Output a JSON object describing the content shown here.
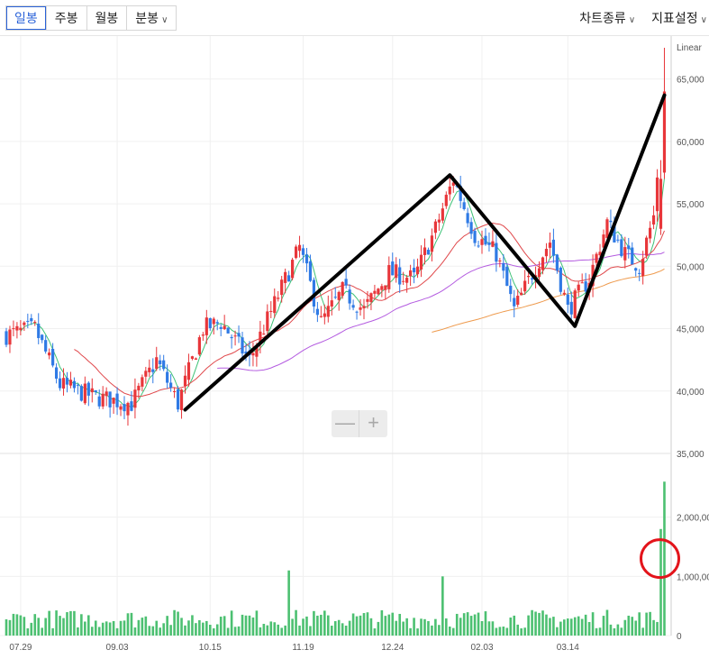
{
  "toolbar": {
    "period_tabs": [
      {
        "label": "일봉",
        "active": true,
        "has_dropdown": false
      },
      {
        "label": "주봉",
        "active": false,
        "has_dropdown": false
      },
      {
        "label": "월봉",
        "active": false,
        "has_dropdown": false
      },
      {
        "label": "분봉",
        "active": false,
        "has_dropdown": true
      }
    ],
    "chart_type_label": "차트종류",
    "indicator_label": "지표설정",
    "dropdown_icon": "chevron-down-icon"
  },
  "zoom": {
    "minus_icon": "minus-icon",
    "plus_icon": "plus-icon"
  },
  "colors": {
    "up": "#e8363a",
    "down": "#2f7ae5",
    "volume": "#4cc071",
    "ma5": "#3ec277",
    "ma20": "#e0484b",
    "ma60": "#b45ce0",
    "ma120": "#ee9a4d",
    "drawing": "#000000",
    "highlight_circle": "#e3141b",
    "grid": "#f0f0f0"
  },
  "chart_data": {
    "type": "candlestick",
    "scale_label": "Linear",
    "price_axis": {
      "ylim": [
        35000,
        67500
      ],
      "ticks": [
        "35,000",
        "40,000",
        "45,000",
        "50,000",
        "55,000",
        "60,000",
        "65,000"
      ]
    },
    "volume_axis": {
      "ylim": [
        0,
        3000000
      ],
      "ticks": [
        "0",
        "1,000,00",
        "2,000,00"
      ]
    },
    "x_tick_labels": [
      "07.29",
      "09.03",
      "10.15",
      "11.19",
      "12.24",
      "02.03",
      "03.14"
    ],
    "price_anchors": [
      {
        "i": 0,
        "p": 44500
      },
      {
        "i": 8,
        "p": 45000
      },
      {
        "i": 15,
        "p": 40500
      },
      {
        "i": 25,
        "p": 39500
      },
      {
        "i": 35,
        "p": 39000
      },
      {
        "i": 42,
        "p": 42500
      },
      {
        "i": 48,
        "p": 39000
      },
      {
        "i": 55,
        "p": 45000
      },
      {
        "i": 60,
        "p": 45500
      },
      {
        "i": 68,
        "p": 42500
      },
      {
        "i": 75,
        "p": 47000
      },
      {
        "i": 82,
        "p": 51500
      },
      {
        "i": 88,
        "p": 45500
      },
      {
        "i": 94,
        "p": 48000
      },
      {
        "i": 100,
        "p": 46500
      },
      {
        "i": 107,
        "p": 49500
      },
      {
        "i": 114,
        "p": 49000
      },
      {
        "i": 120,
        "p": 53000
      },
      {
        "i": 125,
        "p": 57000
      },
      {
        "i": 131,
        "p": 52500
      },
      {
        "i": 137,
        "p": 51000
      },
      {
        "i": 142,
        "p": 46500
      },
      {
        "i": 148,
        "p": 50000
      },
      {
        "i": 152,
        "p": 52000
      },
      {
        "i": 157,
        "p": 46500
      },
      {
        "i": 163,
        "p": 49000
      },
      {
        "i": 168,
        "p": 53500
      },
      {
        "i": 173,
        "p": 51000
      },
      {
        "i": 177,
        "p": 50000
      },
      {
        "i": 181,
        "p": 54000
      },
      {
        "i": 184,
        "p": 64000
      }
    ],
    "volume_spikes": [
      {
        "i": 79,
        "v": 1100000
      },
      {
        "i": 122,
        "v": 1000000
      },
      {
        "i": 184,
        "v": 2600000
      },
      {
        "i": 183,
        "v": 1800000
      }
    ],
    "drawn_line": [
      {
        "i": 50,
        "p": 38500
      },
      {
        "i": 124,
        "p": 57300
      },
      {
        "i": 159,
        "p": 45200
      },
      {
        "i": 184,
        "p": 63700
      }
    ],
    "highlight_circle": {
      "i": 183,
      "v": 1300000
    }
  }
}
